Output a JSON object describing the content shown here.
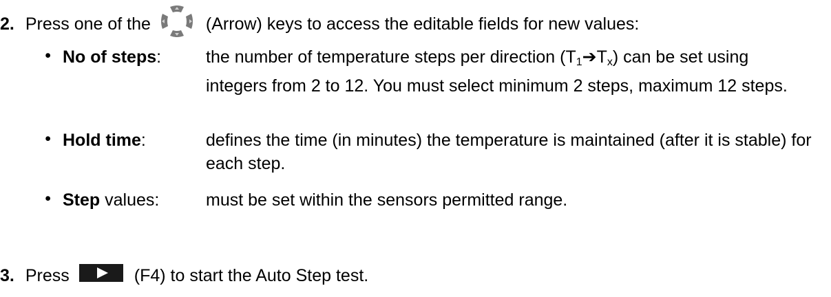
{
  "step2": {
    "number": "2.",
    "text_before_icon": "Press one of the",
    "icon": "arrow-keys-icon",
    "text_after_icon": "(Arrow) keys to access the editable fields for new values:"
  },
  "bullets": [
    {
      "bullet": "•",
      "term_bold": "No of steps",
      "term_suffix": ":",
      "desc_part1": "the number of temperature steps per direction (T",
      "desc_sub1": "1",
      "desc_arrow": "➔",
      "desc_part2": "T",
      "desc_sub2": "x",
      "desc_part3": ") can be set using integers from 2 to 12. You must select minimum 2 steps, maximum 12 steps."
    },
    {
      "bullet": "•",
      "term_bold": "Hold time",
      "term_suffix": ":",
      "desc": "defines the time (in minutes) the temperature is maintained (after it is stable) for each step."
    },
    {
      "bullet": "•",
      "term_bold": "Step",
      "term_suffix": " values:",
      "desc": "must be set within the sensors permitted range."
    }
  ],
  "step3": {
    "number": "3.",
    "text_before_icon": "Press",
    "icon": "play-key-icon",
    "text_after_icon": "(F4) to start the Auto Step test."
  },
  "colors": {
    "text": "#000000",
    "key_background": "#1a1a1a",
    "key_symbol": "#ffffff",
    "arrow_keys": "#7a7a7a"
  }
}
